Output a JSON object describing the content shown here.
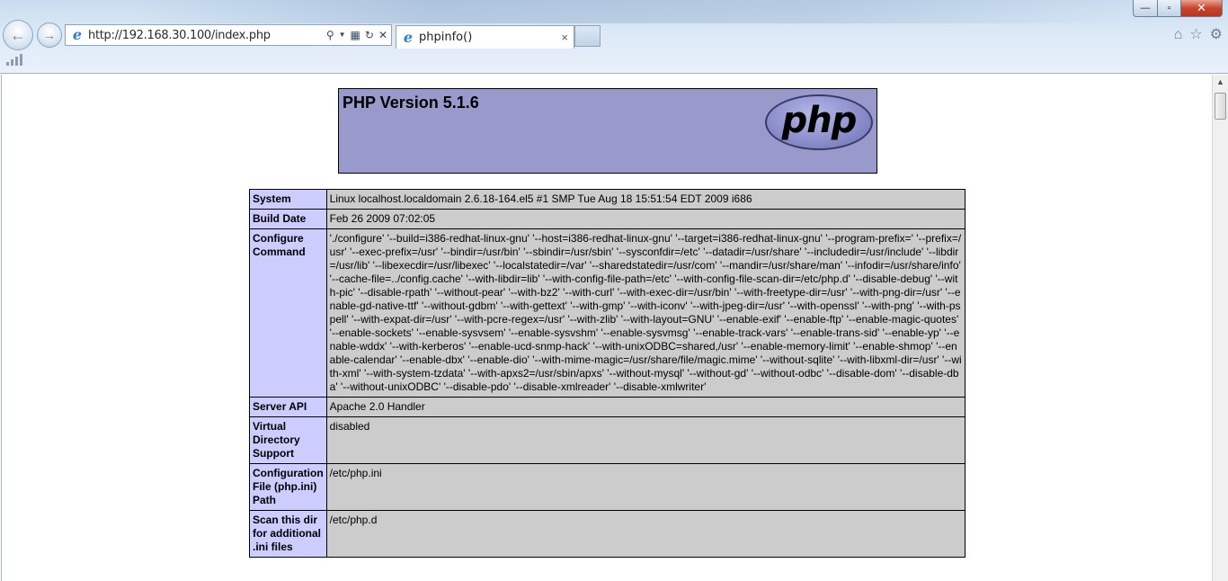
{
  "browser": {
    "url": "http://192.168.30.100/index.php",
    "tab_title": "phpinfo()",
    "tab_close": "×",
    "window_controls": {
      "minimize": "—",
      "maximize": "▫",
      "close": "✕"
    },
    "icons": [
      "back-arrow-icon",
      "forward-arrow-icon",
      "ie-icon",
      "search-icon",
      "dropdown-icon",
      "compat-view-icon",
      "refresh-icon",
      "stop-icon",
      "home-icon",
      "favorites-star-icon",
      "gear-icon",
      "signal-icon"
    ]
  },
  "page": {
    "header_title": "PHP Version 5.1.6",
    "logo_text": "php",
    "rows": [
      {
        "label": "System",
        "value": "Linux localhost.localdomain 2.6.18-164.el5 #1 SMP Tue Aug 18 15:51:54 EDT 2009 i686"
      },
      {
        "label": "Build Date",
        "value": "Feb 26 2009 07:02:05"
      },
      {
        "label": "Configure Command",
        "value": "'./configure' '--build=i386-redhat-linux-gnu' '--host=i386-redhat-linux-gnu' '--target=i386-redhat-linux-gnu' '--program-prefix=' '--prefix=/usr' '--exec-prefix=/usr' '--bindir=/usr/bin' '--sbindir=/usr/sbin' '--sysconfdir=/etc' '--datadir=/usr/share' '--includedir=/usr/include' '--libdir=/usr/lib' '--libexecdir=/usr/libexec' '--localstatedir=/var' '--sharedstatedir=/usr/com' '--mandir=/usr/share/man' '--infodir=/usr/share/info' '--cache-file=../config.cache' '--with-libdir=lib' '--with-config-file-path=/etc' '--with-config-file-scan-dir=/etc/php.d' '--disable-debug' '--with-pic' '--disable-rpath' '--without-pear' '--with-bz2' '--with-curl' '--with-exec-dir=/usr/bin' '--with-freetype-dir=/usr' '--with-png-dir=/usr' '--enable-gd-native-ttf' '--without-gdbm' '--with-gettext' '--with-gmp' '--with-iconv' '--with-jpeg-dir=/usr' '--with-openssl' '--with-png' '--with-pspell' '--with-expat-dir=/usr' '--with-pcre-regex=/usr' '--with-zlib' '--with-layout=GNU' '--enable-exif' '--enable-ftp' '--enable-magic-quotes' '--enable-sockets' '--enable-sysvsem' '--enable-sysvshm' '--enable-sysvmsg' '--enable-track-vars' '--enable-trans-sid' '--enable-yp' '--enable-wddx' '--with-kerberos' '--enable-ucd-snmp-hack' '--with-unixODBC=shared,/usr' '--enable-memory-limit' '--enable-shmop' '--enable-calendar' '--enable-dbx' '--enable-dio' '--with-mime-magic=/usr/share/file/magic.mime' '--without-sqlite' '--with-libxml-dir=/usr' '--with-xml' '--with-system-tzdata' '--with-apxs2=/usr/sbin/apxs' '--without-mysql' '--without-gd' '--without-odbc' '--disable-dom' '--disable-dba' '--without-unixODBC' '--disable-pdo' '--disable-xmlreader' '--disable-xmlwriter'"
      },
      {
        "label": "Server API",
        "value": "Apache 2.0 Handler"
      },
      {
        "label": "Virtual Directory Support",
        "value": "disabled"
      },
      {
        "label": "Configuration File (php.ini) Path",
        "value": "/etc/php.ini"
      },
      {
        "label": "Scan this dir for additional .ini files",
        "value": "/etc/php.d"
      }
    ]
  },
  "colors": {
    "header_bg": "#9999cc",
    "label_bg": "#ccccff",
    "value_bg": "#cccccc"
  }
}
